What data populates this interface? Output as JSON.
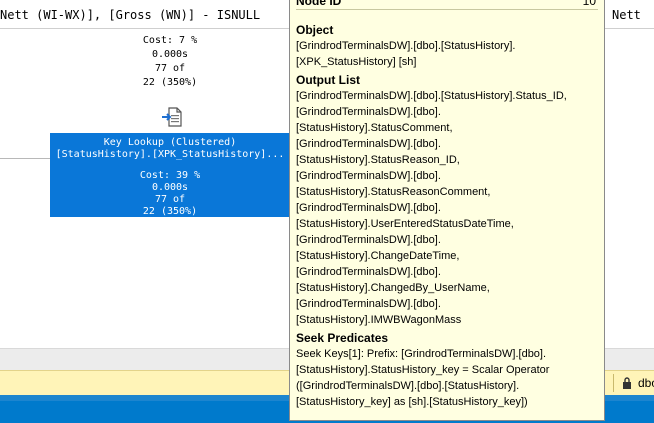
{
  "expression_bar": {
    "left_text": "Nett (WI-WX)], [Gross (WN)] - ISNULL",
    "right_text": "Nett"
  },
  "upper_node_stats": {
    "cost": "Cost: 7 %",
    "time": "0.000s",
    "rows_actual": "77 of",
    "rows_estimated": "22 (350%)"
  },
  "selected_node": {
    "title": "Key Lookup (Clustered)",
    "object": "[StatusHistory].[XPK_StatusHistory]...",
    "cost": "Cost: 39 %",
    "time": "0.000s",
    "rows_actual": "77 of",
    "rows_estimated": "22 (350%)"
  },
  "tooltip": {
    "node_id_label": "Node ID",
    "node_id_value": "10",
    "object_heading": "Object",
    "object_lines": [
      "[GrindrodTerminalsDW].[dbo].[StatusHistory].",
      "[XPK_StatusHistory] [sh]"
    ],
    "output_heading": "Output List",
    "output_lines": [
      "[GrindrodTerminalsDW].[dbo].[StatusHistory].Status_ID,",
      "[GrindrodTerminalsDW].[dbo].",
      "[StatusHistory].StatusComment,",
      "[GrindrodTerminalsDW].[dbo].",
      "[StatusHistory].StatusReason_ID,",
      "[GrindrodTerminalsDW].[dbo].",
      "[StatusHistory].StatusReasonComment,",
      "[GrindrodTerminalsDW].[dbo].",
      "[StatusHistory].UserEnteredStatusDateTime,",
      "[GrindrodTerminalsDW].[dbo].",
      "[StatusHistory].ChangeDateTime,",
      "[GrindrodTerminalsDW].[dbo].",
      "[StatusHistory].ChangedBy_UserName,",
      "[GrindrodTerminalsDW].[dbo].",
      "[StatusHistory].IMWBWagonMass"
    ],
    "seek_heading": "Seek Predicates",
    "seek_lines": [
      "Seek Keys[1]: Prefix: [GrindrodTerminalsDW].[dbo].",
      "[StatusHistory].StatusHistory_key = Scalar Operator",
      "([GrindrodTerminalsDW].[dbo].[StatusHistory].",
      "[StatusHistory_key] as [sh].[StatusHistory_key])"
    ]
  },
  "status_bar": {
    "db_text": "dbo",
    "lock_icon": "lock-icon"
  },
  "colors": {
    "selected_node_bg": "#0a77d8",
    "tooltip_bg": "#ffffe1",
    "status_bar_bg": "#007acc",
    "info_bar_bg": "#fff4b8"
  }
}
